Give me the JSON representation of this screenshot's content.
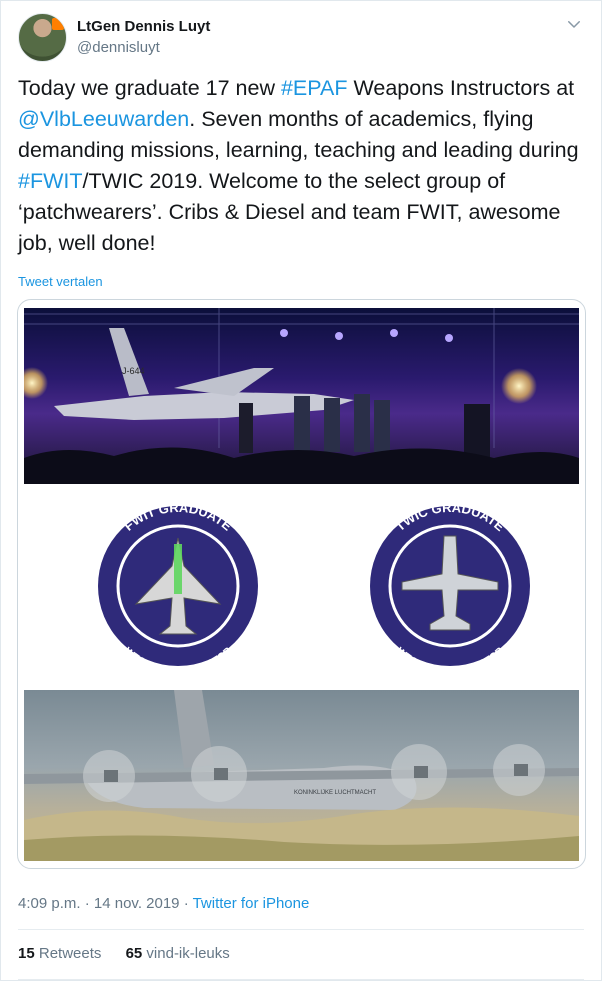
{
  "author": {
    "name": "LtGen Dennis Luyt",
    "handle": "@dennisluyt"
  },
  "tweet": {
    "p1": "Today we graduate 17 new ",
    "hashtag_epaf": "#EPAF",
    "p2": " Weapons Instructors at ",
    "mention": "@VlbLeeuwarden",
    "p3": ". Seven months of academics, flying demanding missions, learning, teaching and leading during ",
    "hashtag_fwit": "#FWIT",
    "p4": "/TWIC 2019. Welcome to the select group of ‘patchwearers’. Cribs & Diesel and team FWIT, awesome job, well done!"
  },
  "translate_label": "Tweet vertalen",
  "media": {
    "jet_tail": "J-644",
    "patch_left_top": "FWIT GRADUATE",
    "patch_left_bottom": "WEAPONS INSTRUCTOR",
    "patch_right_top": "TWIC GRADUATE",
    "patch_right_bottom": "WEAPONS INSTRUCTOR",
    "c130_marking": "KONINKLIJKE LUCHTMACHT"
  },
  "meta": {
    "time": "4:09 p.m.",
    "separator": " · ",
    "date": "14 nov. 2019",
    "source": "Twitter for iPhone"
  },
  "stats": {
    "retweets_count": "15",
    "retweets_label": "Retweets",
    "likes_count": "65",
    "likes_label": "vind-ik-leuks"
  },
  "colors": {
    "link": "#1b95e0",
    "patch_purple": "#2f2a7a",
    "secondary_text": "#657786"
  }
}
